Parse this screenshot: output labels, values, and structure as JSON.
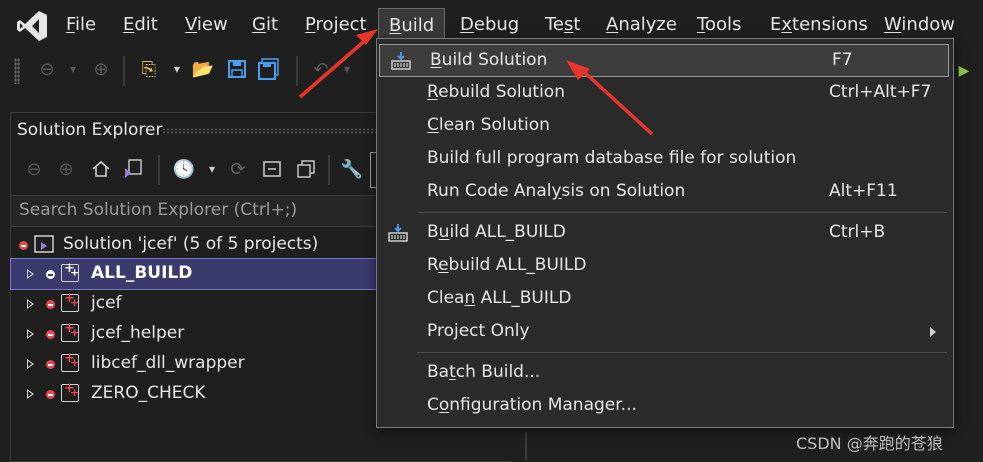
{
  "menubar": {
    "items": [
      {
        "label": "File",
        "key": "F",
        "rest": "ile"
      },
      {
        "label": "Edit",
        "key": "E",
        "rest": "dit"
      },
      {
        "label": "View",
        "key": "V",
        "rest": "iew"
      },
      {
        "label": "Git",
        "key": "G",
        "rest": "it"
      },
      {
        "label": "Project",
        "key": "P",
        "rest": "roject"
      },
      {
        "label": "Build",
        "key": "B",
        "rest": "uild"
      },
      {
        "label": "Debug",
        "key": "D",
        "rest": "ebug"
      },
      {
        "label": "Test",
        "pre": "Te",
        "key": "s",
        "rest": "t"
      },
      {
        "label": "Analyze",
        "key": "A",
        "rest": "nalyze"
      },
      {
        "label": "Tools",
        "key": "T",
        "rest": "ools"
      },
      {
        "label": "Extensions",
        "pre": "E",
        "key": "x",
        "rest": "tensions"
      },
      {
        "label": "Window",
        "key": "W",
        "rest": "indow"
      }
    ]
  },
  "solution_explorer": {
    "title": "Solution Explorer",
    "search_placeholder": "Search Solution Explorer (Ctrl+;)",
    "solution_label": "Solution 'jcef' (5 of 5 projects)",
    "projects": [
      "ALL_BUILD",
      "jcef",
      "jcef_helper",
      "libcef_dll_wrapper",
      "ZERO_CHECK"
    ]
  },
  "build_menu": {
    "items": [
      {
        "pre": "",
        "key": "B",
        "rest": "uild Solution",
        "shortcut": "F7"
      },
      {
        "pre": "",
        "key": "R",
        "rest": "ebuild Solution",
        "shortcut": "Ctrl+Alt+F7"
      },
      {
        "pre": "",
        "key": "C",
        "rest": "lean Solution",
        "shortcut": ""
      },
      {
        "pre": "Build full program database file for solution",
        "key": "",
        "rest": "",
        "shortcut": ""
      },
      {
        "pre": "Run Code Anal",
        "key": "y",
        "rest": "sis on Solution",
        "shortcut": "Alt+F11"
      },
      {
        "pre": "",
        "key": "u",
        "rest": "ild ALL_BUILD",
        "lead": "B",
        "shortcut": "Ctrl+B"
      },
      {
        "pre": "R",
        "key": "e",
        "rest": "build ALL_BUILD",
        "shortcut": ""
      },
      {
        "pre": "Clea",
        "key": "n",
        "rest": " ALL_BUILD",
        "shortcut": ""
      },
      {
        "pre": "Project Only",
        "key": "",
        "rest": "",
        "shortcut": ""
      },
      {
        "pre": "Ba",
        "key": "t",
        "rest": "ch Build...",
        "shortcut": ""
      },
      {
        "pre": "C",
        "key": "o",
        "rest": "nfiguration Manager...",
        "shortcut": ""
      }
    ]
  },
  "watermark": "CSDN @奔跑的苍狼",
  "colors": {
    "accent": "#7a77d1",
    "arrow": "#e8352c",
    "error_dot": "#e5484d",
    "selection": "#3a3a6c"
  }
}
